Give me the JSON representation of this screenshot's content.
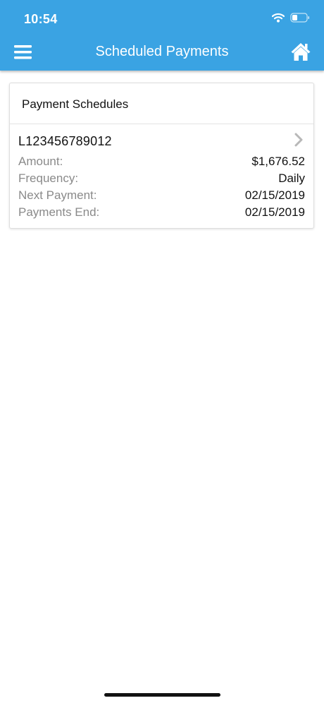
{
  "status_bar": {
    "time": "10:54",
    "icons": [
      "wifi-icon",
      "battery-icon"
    ]
  },
  "nav": {
    "title": "Scheduled Payments",
    "left_icon": "menu-icon",
    "right_icon": "home-icon"
  },
  "card": {
    "title": "Payment Schedules",
    "schedules": [
      {
        "loan_number": "L123456789012",
        "amount_label": "Amount:",
        "amount": "$1,676.52",
        "frequency_label": "Frequency:",
        "frequency": "Daily",
        "next_payment_label": "Next Payment:",
        "next_payment": "02/15/2019",
        "payments_end_label": "Payments End:",
        "payments_end": "02/15/2019"
      }
    ]
  },
  "colors": {
    "header": "#3aa3e3",
    "label_gray": "#8a8a8a",
    "text": "#111111"
  }
}
